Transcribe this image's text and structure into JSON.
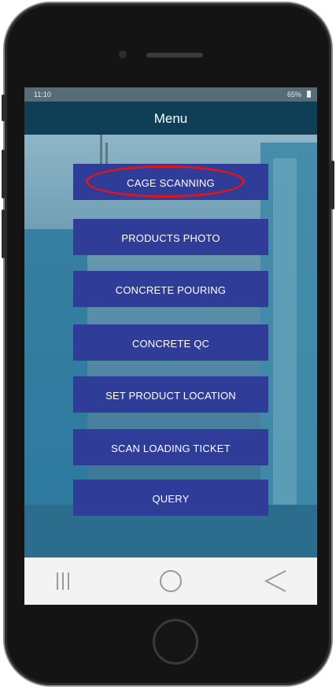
{
  "status_bar": {
    "time": "11:10",
    "battery": "65%"
  },
  "header": {
    "title": "Menu"
  },
  "menu": {
    "items": [
      {
        "label": "CAGE SCANNING"
      },
      {
        "label": "PRODUCTS PHOTO"
      },
      {
        "label": "CONCRETE POURING"
      },
      {
        "label": "CONCRETE QC"
      },
      {
        "label": "SET PRODUCT LOCATION"
      },
      {
        "label": "SCAN LOADING TICKET"
      },
      {
        "label": "QUERY"
      }
    ],
    "highlighted_item": "CAGE SCANNING",
    "highlight_color": "#e1141a",
    "button_color": "#2f3d99"
  },
  "nav_bar": {
    "items": [
      {
        "icon": "recent-apps-icon"
      },
      {
        "icon": "home-icon"
      },
      {
        "icon": "back-icon"
      }
    ]
  },
  "colors": {
    "header": "#0e3f56",
    "status_bar": "#566d77",
    "nav_bar": "#f3f3f3"
  }
}
